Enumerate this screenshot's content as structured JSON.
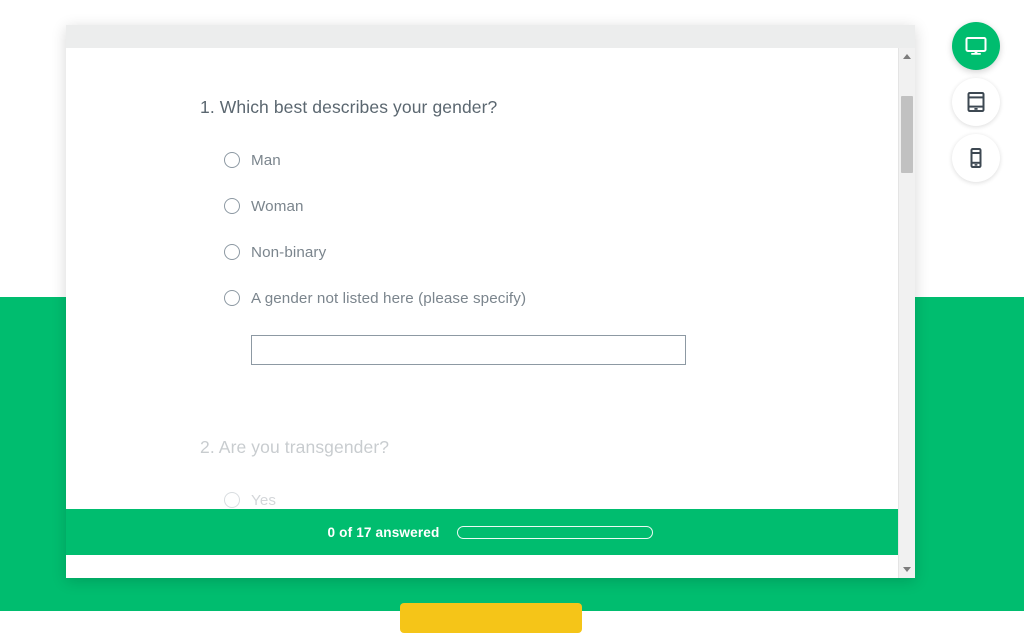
{
  "page": {
    "background_top_color": "#ffffff",
    "background_bottom_color": "#00bd6f",
    "cta_color": "#f5c518"
  },
  "survey": {
    "questions": [
      {
        "number": "1.",
        "title": "1. Which best describes your gender?",
        "options": [
          {
            "label": "Man",
            "selected": false
          },
          {
            "label": "Woman",
            "selected": false
          },
          {
            "label": "Non-binary",
            "selected": false
          },
          {
            "label": "A gender not listed here (please specify)",
            "selected": false
          }
        ],
        "other_input": {
          "value": "",
          "placeholder": ""
        }
      },
      {
        "number": "2.",
        "title": "2. Are you transgender?",
        "options": [
          {
            "label": "Yes",
            "selected": false
          }
        ]
      }
    ],
    "footer": {
      "answered_text": "0 of 17 answered",
      "answered_count": 0,
      "total_questions": 17,
      "progress_percent": 0,
      "background_color": "#00bd6f"
    }
  },
  "scrollbar": {
    "up_arrow_icon": "chevron-up-icon",
    "down_arrow_icon": "chevron-down-icon",
    "thumb_position_percent": 5
  },
  "device_preview": {
    "buttons": [
      {
        "name": "desktop",
        "icon": "desktop-icon",
        "active": true
      },
      {
        "name": "tablet",
        "icon": "tablet-icon",
        "active": false
      },
      {
        "name": "mobile",
        "icon": "mobile-icon",
        "active": false
      }
    ],
    "active_color": "#00bd6f",
    "inactive_icon_color": "#3d4852"
  }
}
